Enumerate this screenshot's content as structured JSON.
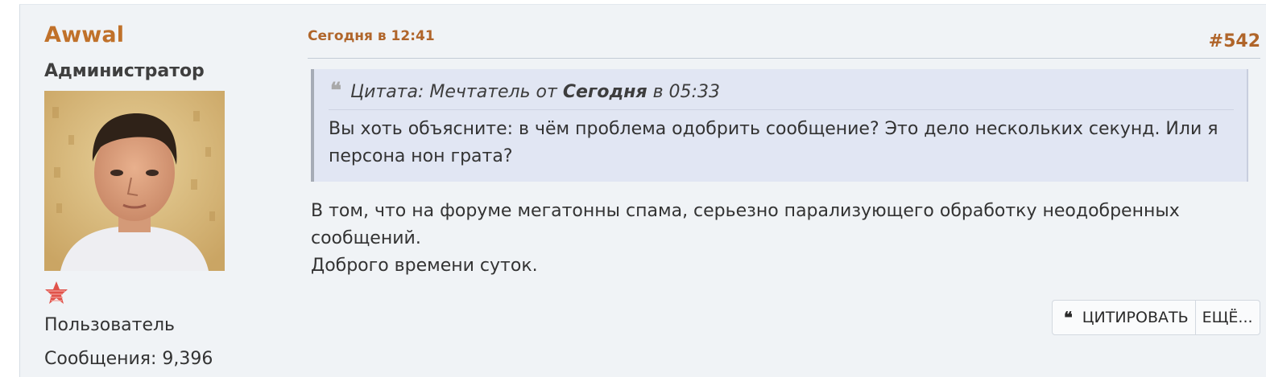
{
  "user": {
    "name": "Awwal",
    "title": "Администратор",
    "group": "Пользователь",
    "posts_label": "Сообщения: 9,396"
  },
  "post": {
    "date": "Сегодня в 12:41",
    "number": "#542",
    "quote": {
      "icon": "quote-icon",
      "prefix": "Цитата: Мечтатель от ",
      "day": "Сегодня",
      "time_suffix": " в 05:33",
      "text": "Вы хоть объясните: в чём проблема одобрить сообщение? Это дело нескольких секунд. Или я персона нон грата?"
    },
    "body_line1": "В том, что на форуме мегатонны спама, серьезно парализующего обработку неодобренных сообщений.",
    "body_line2": "Доброго времени суток."
  },
  "actions": {
    "quote_label": "ЦИТИРОВАТЬ",
    "more_label": "ЕЩЁ..."
  },
  "colors": {
    "accent": "#c0712a",
    "post_bg": "#f0f3f6",
    "quote_bg": "#e1e6f3",
    "rank_star": "#e0524a"
  }
}
